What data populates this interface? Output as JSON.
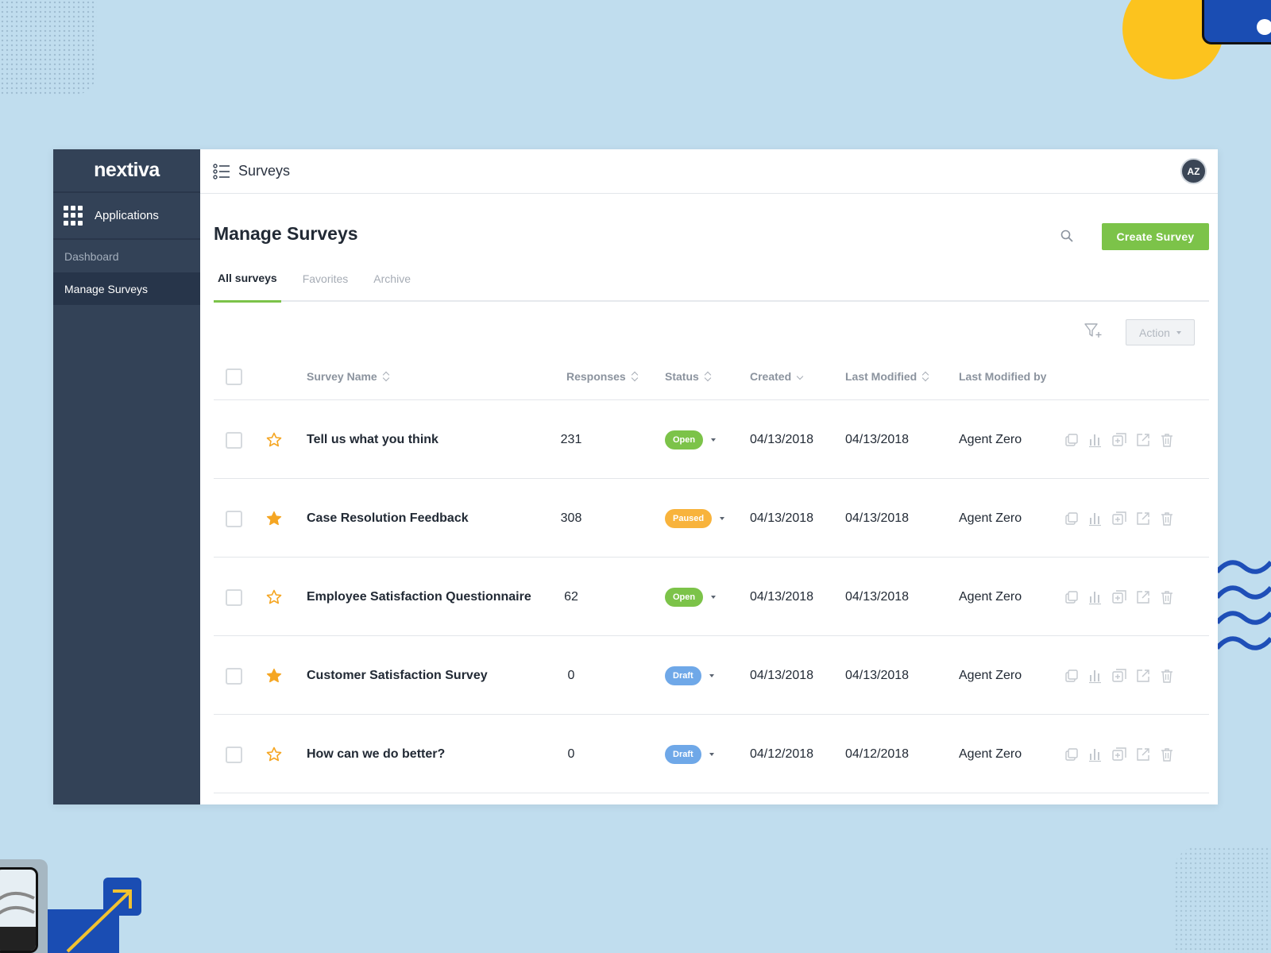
{
  "brand": {
    "logo_text": "nextiva"
  },
  "sidebar": {
    "apps_label": "Applications",
    "items": [
      {
        "label": "Dashboard",
        "active": false
      },
      {
        "label": "Manage Surveys",
        "active": true
      }
    ]
  },
  "topbar": {
    "title": "Surveys",
    "avatar_initials": "AZ"
  },
  "page": {
    "title": "Manage Surveys",
    "create_label": "Create Survey",
    "action_label": "Action"
  },
  "tabs": [
    {
      "label": "All surveys",
      "active": true
    },
    {
      "label": "Favorites",
      "active": false
    },
    {
      "label": "Archive",
      "active": false
    }
  ],
  "table": {
    "headers": {
      "name": "Survey Name",
      "responses": "Responses",
      "status": "Status",
      "created": "Created",
      "modified": "Last Modified",
      "modified_by": "Last Modified by"
    },
    "rows": [
      {
        "name": "Tell us what you think",
        "favorite": false,
        "responses": "231",
        "status": "Open",
        "created": "04/13/2018",
        "modified": "04/13/2018",
        "modified_by": "Agent Zero"
      },
      {
        "name": "Case Resolution Feedback",
        "favorite": true,
        "responses": "308",
        "status": "Paused",
        "created": "04/13/2018",
        "modified": "04/13/2018",
        "modified_by": "Agent Zero"
      },
      {
        "name": "Employee Satisfaction Questionnaire",
        "favorite": false,
        "responses": "62",
        "status": "Open",
        "created": "04/13/2018",
        "modified": "04/13/2018",
        "modified_by": "Agent Zero"
      },
      {
        "name": "Customer Satisfaction Survey",
        "favorite": true,
        "responses": "0",
        "status": "Draft",
        "created": "04/13/2018",
        "modified": "04/13/2018",
        "modified_by": "Agent Zero"
      },
      {
        "name": "How can we do better?",
        "favorite": false,
        "responses": "0",
        "status": "Draft",
        "created": "04/12/2018",
        "modified": "04/12/2018",
        "modified_by": "Agent Zero"
      }
    ],
    "row_actions": [
      "copy-icon",
      "bar-chart-icon",
      "add-icon",
      "share-icon",
      "trash-icon"
    ]
  },
  "colors": {
    "sidebar": "#334257",
    "accent_green": "#7cc349",
    "status_open": "#7cc349",
    "status_paused": "#f8b33c",
    "status_draft": "#6fa8e8",
    "star": "#f5a623"
  }
}
